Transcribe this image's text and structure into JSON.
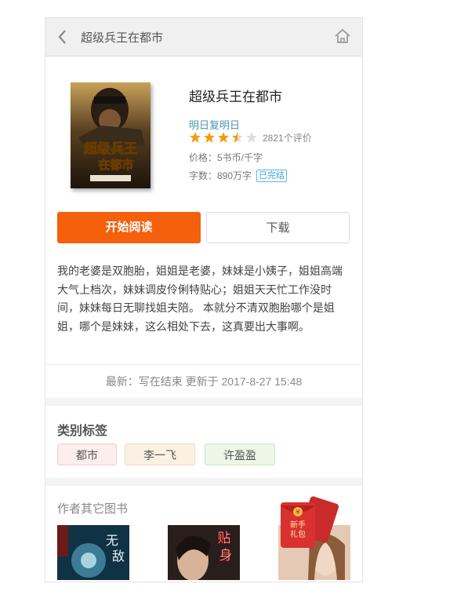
{
  "header": {
    "title": "超级兵王在都市",
    "back_icon": "chevron-left-icon",
    "home_icon": "home-icon"
  },
  "book": {
    "cover_title": "超级兵王在都市",
    "title": "超级兵王在都市",
    "author": "明日复明日",
    "rating": 3.5,
    "rating_count": "2821个评价",
    "price": "价格：5书币/千字",
    "words": "字数：890万字",
    "status": "已完结"
  },
  "actions": {
    "read": "开始阅读",
    "download": "下载"
  },
  "description": "我的老婆是双胞胎，姐姐是老婆，妹妹是小姨子，姐姐高端大气上档次，妹妹调皮伶俐特贴心；姐姐天天忙工作没时间，妹妹每日无聊找姐夫陪。 本就分不清双胞胎哪个是姐姐，哪个是妹妹，这么相处下去，这真要出大事啊。",
  "latest": "最新：写在结束 更新于 2017-8-27 15:48",
  "tags": {
    "title": "类别标签",
    "items": [
      "都市",
      "李一飞",
      "许盈盈"
    ]
  },
  "others": {
    "title": "作者其它图书"
  },
  "gift": {
    "label_line1": "新手",
    "label_line2": "礼包"
  },
  "colors": {
    "accent": "#f4600c",
    "author": "#4a95b9",
    "star": "#f39c12"
  }
}
